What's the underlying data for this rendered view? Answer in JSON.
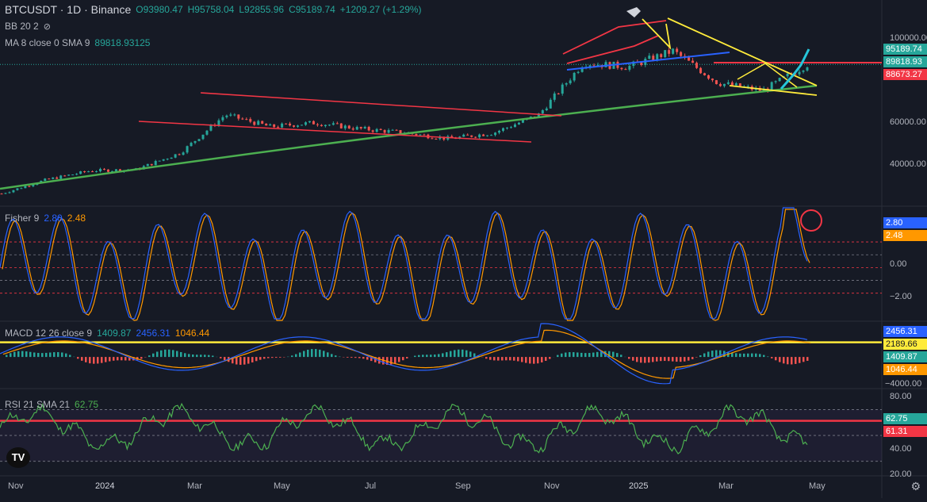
{
  "header": {
    "symbol": "BTCUSDT · 1D · Binance",
    "ohlc": {
      "o": "O93980.47",
      "h": "H95758.04",
      "l": "L92855.96",
      "c": "C95189.74",
      "chg": "+1209.27 (+1.29%)"
    },
    "bb": "BB 20 2",
    "ma_label": "MA 8 close 0 SMA 9",
    "ma_value": "89818.93125"
  },
  "indicators": {
    "fisher": {
      "label": "Fisher 9",
      "v1": "2.80",
      "v2": "2.48"
    },
    "macd": {
      "label": "MACD 12 26 close 9",
      "v1": "1409.87",
      "v2": "2456.31",
      "v3": "1046.44"
    },
    "rsi": {
      "label": "RSI 21 SMA 21",
      "v1": "62.75"
    }
  },
  "price_tags": [
    {
      "text": "95189.74",
      "color": "#26a69a"
    },
    {
      "text": "89818.93",
      "color": "#26a69a"
    },
    {
      "text": "88673.27",
      "color": "#f23645"
    }
  ],
  "fisher_tags": [
    {
      "text": "2.80",
      "color": "#2962ff"
    },
    {
      "text": "2.48",
      "color": "#ff9800"
    }
  ],
  "macd_tags": [
    {
      "text": "2456.31",
      "color": "#2962ff"
    },
    {
      "text": "2189.66",
      "color": "#ffeb3b"
    },
    {
      "text": "1409.87",
      "color": "#26a69a"
    },
    {
      "text": "1046.44",
      "color": "#ff9800"
    }
  ],
  "rsi_tags": [
    {
      "text": "62.75",
      "color": "#26a69a"
    },
    {
      "text": "61.31",
      "color": "#f23645"
    }
  ],
  "axes": {
    "price_ticks": [
      "100000.00",
      "60000.00",
      "40000.00"
    ],
    "fisher_ticks": [
      "0.00",
      "−2.00"
    ],
    "macd_ticks": [
      "−4000.00"
    ],
    "rsi_ticks": [
      "80.00",
      "40.00",
      "20.00"
    ],
    "time_ticks": [
      "Nov",
      "2024",
      "Mar",
      "May",
      "Jul",
      "Sep",
      "Nov",
      "2025",
      "Mar",
      "May"
    ]
  },
  "logo_text": "TV",
  "colors": {
    "bg": "#161a25",
    "up": "#26a69a",
    "down": "#ef5350",
    "fisher": "#2962ff",
    "signal": "#ff9800",
    "rsi": "#4caf50"
  },
  "chart_data": {
    "type": "candlestick",
    "price": {
      "dates": [
        "2023-10",
        "2023-11",
        "2023-12",
        "2024-01",
        "2024-02",
        "2024-03",
        "2024-04",
        "2024-05",
        "2024-06",
        "2024-07",
        "2024-08",
        "2024-09",
        "2024-10",
        "2024-11",
        "2024-12",
        "2025-01",
        "2025-02",
        "2025-03",
        "2025-04"
      ],
      "close": [
        30500,
        37500,
        42000,
        42500,
        51000,
        70000,
        64000,
        66000,
        63000,
        61000,
        58000,
        61000,
        70000,
        96000,
        94000,
        102000,
        86000,
        82000,
        95189.74
      ],
      "ylim": [
        25000,
        110000
      ]
    },
    "fisher": {
      "current": 2.8,
      "signal": 2.48,
      "ylim": [
        -3,
        3.5
      ]
    },
    "macd": {
      "macd": 1409.87,
      "signal": 1046.44,
      "hist_ref": 2456.31,
      "level": 2189.66,
      "ylim": [
        -4500,
        5000
      ]
    },
    "rsi": {
      "current": 62.75,
      "sma": 61.31,
      "ylim": [
        20,
        85
      ],
      "bands": [
        70,
        50,
        30
      ]
    },
    "annotations": [
      "circle on Fisher peak",
      "yellow horizontal line on MACD",
      "red horizontal line on RSI near 61",
      "green long-term uptrend line",
      "red descending channel"
    ]
  }
}
